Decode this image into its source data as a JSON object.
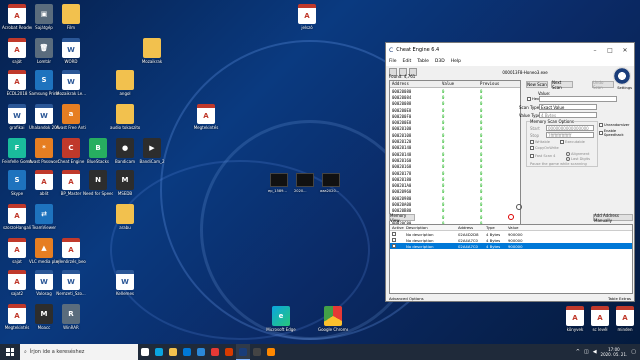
{
  "desktop": {
    "icons": [
      {
        "label": "Acrobat Reader DC",
        "type": "pdf",
        "glyph": "A"
      },
      {
        "label": "Sajátgép",
        "type": "app",
        "glyph": "▣"
      },
      {
        "label": "Film",
        "type": "folder",
        "glyph": ""
      },
      {
        "label": "saját",
        "type": "pdf",
        "glyph": "A"
      },
      {
        "label": "Lomtár",
        "type": "app",
        "glyph": "🗑"
      },
      {
        "label": "WORD",
        "type": "word",
        "glyph": "W"
      },
      {
        "label": "Mozaikrak",
        "type": "folder",
        "glyph": ""
      },
      {
        "label": "ECDL2018",
        "type": "pdf",
        "glyph": "A"
      },
      {
        "label": "Samsung Printer Diagnostics",
        "type": "blue",
        "glyph": "S"
      },
      {
        "label": "Mozaikrak Le...",
        "type": "word",
        "glyph": "W"
      },
      {
        "label": "angol",
        "type": "folder",
        "glyph": ""
      },
      {
        "label": "grafikai",
        "type": "word",
        "glyph": "W"
      },
      {
        "label": "Uhalandok 2007 5p",
        "type": "word",
        "glyph": "W"
      },
      {
        "label": "Avast Free Antivirus",
        "type": "orange",
        "glyph": "a"
      },
      {
        "label": "audio tokaszitokra",
        "type": "folder",
        "glyph": ""
      },
      {
        "label": "Megtekintés",
        "type": "pdf",
        "glyph": "A"
      },
      {
        "label": "Feinfelle Gombatom",
        "type": "teal",
        "glyph": "F"
      },
      {
        "label": "Avast Passwords",
        "type": "orange",
        "glyph": "*"
      },
      {
        "label": "Cheat Engine",
        "type": "red",
        "glyph": "C"
      },
      {
        "label": "BlueStacks",
        "type": "green",
        "glyph": "B"
      },
      {
        "label": "Bandicam",
        "type": "dark",
        "glyph": "●"
      },
      {
        "label": "BandiCam_2",
        "type": "dark",
        "glyph": "▶"
      },
      {
        "label": "Skype",
        "type": "blue",
        "glyph": "S"
      },
      {
        "label": "ablit",
        "type": "pdf",
        "glyph": "A"
      },
      {
        "label": "BP_Master",
        "type": "pdf",
        "glyph": "A"
      },
      {
        "label": "Need for Speed underground",
        "type": "dark",
        "glyph": "N"
      },
      {
        "label": "MSEDB",
        "type": "dark",
        "glyph": "M"
      },
      {
        "label": "szorzoHangali",
        "type": "pdf",
        "glyph": "A"
      },
      {
        "label": "TeamViewer",
        "type": "blue",
        "glyph": "⇄"
      },
      {
        "label": "arabu",
        "type": "folder",
        "glyph": ""
      },
      {
        "label": "sajat",
        "type": "pdf",
        "glyph": "A"
      },
      {
        "label": "VLC media player",
        "type": "orange",
        "glyph": "▲"
      },
      {
        "label": "ellenőrzés_beos_1",
        "type": "pdf",
        "glyph": "A"
      },
      {
        "label": "sajat2",
        "type": "pdf",
        "glyph": "A"
      },
      {
        "label": "Valosag",
        "type": "word",
        "glyph": "W"
      },
      {
        "label": "Nemzeti_Szo...",
        "type": "word",
        "glyph": "W"
      },
      {
        "label": "Kellemes",
        "type": "word",
        "glyph": "W"
      },
      {
        "label": "Megtekintés",
        "type": "pdf",
        "glyph": "A"
      },
      {
        "label": "Moacc",
        "type": "dark",
        "glyph": "M"
      },
      {
        "label": "WinRAR",
        "type": "app",
        "glyph": "R"
      }
    ],
    "right_icons": [
      {
        "label": "könyvek",
        "type": "pdf",
        "glyph": "A"
      },
      {
        "label": "sc levél",
        "type": "pdf",
        "glyph": "A"
      },
      {
        "label": "minden",
        "type": "pdf",
        "glyph": "A"
      }
    ],
    "top_center_icon": {
      "label": "jelszó",
      "type": "pdf",
      "glyph": "A"
    },
    "thumbnails": [
      {
        "label": "ep_1589...",
        "type": "dark"
      },
      {
        "label": "2020...",
        "type": "dark"
      },
      {
        "label": "aaa2020...",
        "type": "dark"
      }
    ],
    "edge": {
      "label": "Microsoft Edge"
    },
    "chrome": {
      "label": "Google Chrome"
    }
  },
  "cheat_engine": {
    "title": "Cheat Engine 6.4",
    "menu": [
      "File",
      "Edit",
      "Table",
      "D3D",
      "Help"
    ],
    "process": "000013F8-Honeo3.exe",
    "found": "Found: 4,761",
    "columns": [
      "Address",
      "Value",
      "Previous"
    ],
    "rows": [
      {
        "address": "00020080",
        "value": "0",
        "previous": "0"
      },
      {
        "address": "00020084",
        "value": "0",
        "previous": "0"
      },
      {
        "address": "00020088",
        "value": "0",
        "previous": "0"
      },
      {
        "address": "000200E8",
        "value": "0",
        "previous": "0"
      },
      {
        "address": "000200F0",
        "value": "0",
        "previous": "0"
      },
      {
        "address": "000200E8",
        "value": "0",
        "previous": "0"
      },
      {
        "address": "00020100",
        "value": "0",
        "previous": "0"
      },
      {
        "address": "00020108",
        "value": "0",
        "previous": "0"
      },
      {
        "address": "00020120",
        "value": "0",
        "previous": "0"
      },
      {
        "address": "00020140",
        "value": "0",
        "previous": "0"
      },
      {
        "address": "00020148",
        "value": "0",
        "previous": "0"
      },
      {
        "address": "00020160",
        "value": "0",
        "previous": "0"
      },
      {
        "address": "00020168",
        "value": "0",
        "previous": "0"
      },
      {
        "address": "00020178",
        "value": "0",
        "previous": "0"
      },
      {
        "address": "00020180",
        "value": "0",
        "previous": "0"
      },
      {
        "address": "000201A0",
        "value": "0",
        "previous": "0"
      },
      {
        "address": "00020960",
        "value": "0",
        "previous": "0"
      },
      {
        "address": "00020980",
        "value": "0",
        "previous": "0"
      },
      {
        "address": "00020A00",
        "value": "0",
        "previous": "0"
      },
      {
        "address": "00020B80",
        "value": "0",
        "previous": "0"
      },
      {
        "address": "00020C18",
        "value": "0",
        "previous": "0"
      },
      {
        "address": "00020C80",
        "value": "0",
        "previous": "0"
      },
      {
        "address": "00020B10",
        "value": "0",
        "previous": "0"
      }
    ],
    "new_scan": "New Scan",
    "next_scan": "Next Scan",
    "undo_scan": "Undo Scan",
    "value_label": "Value:",
    "hex_label": "Hex",
    "scan_type_label": "Scan Type",
    "scan_type_value": "Exact Value",
    "value_type_label": "Value Type",
    "value_type_value": "4 Bytes",
    "memory_scan_options": "Memory Scan Options",
    "start_label": "Start",
    "start_value": "0000000000000000",
    "stop_label": "Stop",
    "stop_value": "7fffffffffffffff",
    "writable": "Writable",
    "executable": "Executable",
    "copyonwrite": "CopyOnWrite",
    "fast_scan": "Fast Scan",
    "fast_scan_value": "4",
    "alignment": "Alignment",
    "last_digits": "Last Digits",
    "pause_game": "Pause the game while scanning",
    "unrandomizer": "Unrandomizer",
    "speedhack": "Enable Speedhack",
    "settings": "Settings",
    "memory_view": "Memory View",
    "add_address": "Add Address Manually",
    "table_columns": [
      "Active",
      "Description",
      "Address",
      "Type",
      "Value"
    ],
    "table_rows": [
      {
        "desc": "No description",
        "address": "02A4D2D8",
        "type": "4 Bytes",
        "value": "900000",
        "selected": false
      },
      {
        "desc": "No description",
        "address": "02A4A7C0",
        "type": "4 Bytes",
        "value": "900000",
        "selected": false
      },
      {
        "desc": "No description",
        "address": "02A4A7C0",
        "type": "4 Bytes",
        "value": "900000",
        "selected": true
      }
    ],
    "advanced_options": "Advanced Options",
    "table_extras": "Table Extras"
  },
  "taskbar": {
    "search_placeholder": "Írjon ide a kereséshez",
    "time": "17:00",
    "date": "2020. 05. 21.",
    "apps": [
      {
        "name": "task-view",
        "color": "#ffffff",
        "active": false
      },
      {
        "name": "edge",
        "color": "#0aa5e0",
        "active": false
      },
      {
        "name": "explorer",
        "color": "#f2c14e",
        "active": false
      },
      {
        "name": "store",
        "color": "#0078d7",
        "active": false
      },
      {
        "name": "mail",
        "color": "#2b88d8",
        "active": false
      },
      {
        "name": "chrome",
        "color": "#e53935",
        "active": false
      },
      {
        "name": "office",
        "color": "#d83b01",
        "active": false
      },
      {
        "name": "cheat-engine",
        "color": "#1a3d7a",
        "active": true
      },
      {
        "name": "bandicam",
        "color": "#444444",
        "active": false
      },
      {
        "name": "vlc",
        "color": "#ff8800",
        "active": false
      }
    ]
  }
}
